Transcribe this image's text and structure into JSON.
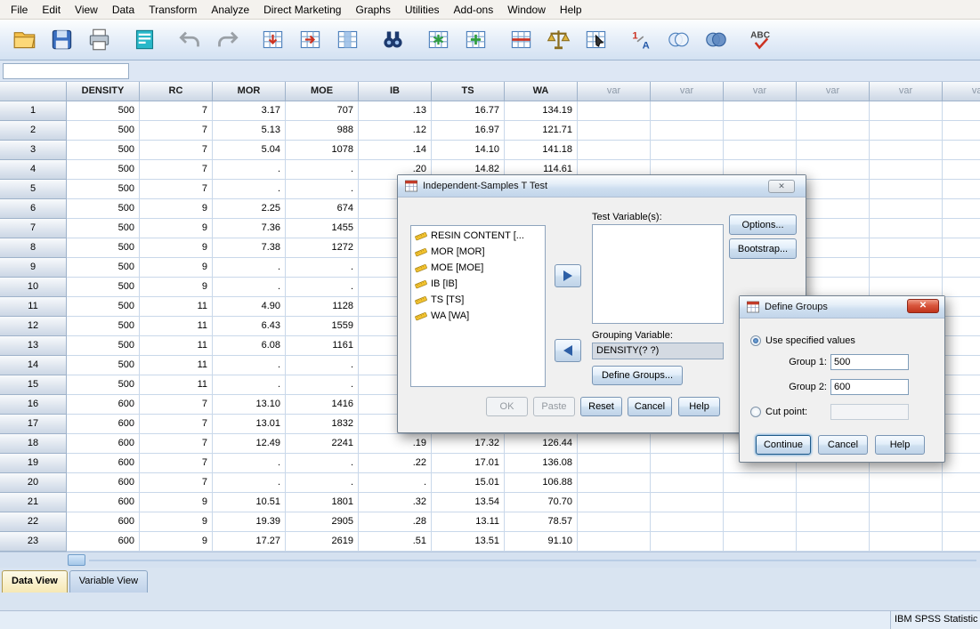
{
  "menu": {
    "items": [
      "File",
      "Edit",
      "View",
      "Data",
      "Transform",
      "Analyze",
      "Direct Marketing",
      "Graphs",
      "Utilities",
      "Add-ons",
      "Window",
      "Help"
    ]
  },
  "toolbar": {
    "buttons": [
      {
        "name": "open-data",
        "icon": "i-folder"
      },
      {
        "name": "save",
        "icon": "i-floppy"
      },
      {
        "name": "print",
        "icon": "i-printer"
      },
      {
        "name": "recall-dialogs",
        "icon": "i-recall"
      },
      {
        "name": "undo",
        "icon": "i-undo"
      },
      {
        "name": "redo",
        "icon": "i-redo"
      },
      {
        "name": "goto-case",
        "icon": "i-goto-case"
      },
      {
        "name": "goto-variable",
        "icon": "i-goto-var"
      },
      {
        "name": "variables",
        "icon": "i-varinfo"
      },
      {
        "name": "find",
        "icon": "i-binoc"
      },
      {
        "name": "insert-cases",
        "icon": "i-ins-case"
      },
      {
        "name": "insert-variable",
        "icon": "i-ins-var"
      },
      {
        "name": "split-file",
        "icon": "i-split"
      },
      {
        "name": "weight-cases",
        "icon": "i-scales"
      },
      {
        "name": "select-cases",
        "icon": "i-select"
      },
      {
        "name": "value-labels",
        "icon": "i-vlabels"
      },
      {
        "name": "use-variable-sets",
        "icon": "i-venn"
      },
      {
        "name": "show-all-variables",
        "icon": "i-venn2"
      },
      {
        "name": "spell-check",
        "icon": "i-abc"
      }
    ]
  },
  "cell_editor": {
    "value": ""
  },
  "grid": {
    "columns": [
      "DENSITY",
      "RC",
      "MOR",
      "MOE",
      "IB",
      "TS",
      "WA",
      "var",
      "var",
      "var",
      "var",
      "var",
      "var"
    ],
    "rows": [
      [
        "500",
        "7",
        "3.17",
        "707",
        ".13",
        "16.77",
        "134.19"
      ],
      [
        "500",
        "7",
        "5.13",
        "988",
        ".12",
        "16.97",
        "121.71"
      ],
      [
        "500",
        "7",
        "5.04",
        "1078",
        ".14",
        "14.10",
        "141.18"
      ],
      [
        "500",
        "7",
        ".",
        ".",
        ".20",
        "14.82",
        "114.61"
      ],
      [
        "500",
        "7",
        ".",
        ".",
        "",
        "",
        ""
      ],
      [
        "500",
        "9",
        "2.25",
        "674",
        "",
        "",
        ""
      ],
      [
        "500",
        "9",
        "7.36",
        "1455",
        "",
        "",
        ""
      ],
      [
        "500",
        "9",
        "7.38",
        "1272",
        "",
        "",
        ""
      ],
      [
        "500",
        "9",
        ".",
        ".",
        "",
        "",
        ""
      ],
      [
        "500",
        "9",
        ".",
        ".",
        "",
        "",
        ""
      ],
      [
        "500",
        "11",
        "4.90",
        "1128",
        "",
        "",
        ""
      ],
      [
        "500",
        "11",
        "6.43",
        "1559",
        "",
        "",
        ""
      ],
      [
        "500",
        "11",
        "6.08",
        "1161",
        "",
        "",
        ""
      ],
      [
        "500",
        "11",
        ".",
        ".",
        "",
        "",
        ""
      ],
      [
        "500",
        "11",
        ".",
        ".",
        "",
        "",
        ""
      ],
      [
        "600",
        "7",
        "13.10",
        "1416",
        "",
        "",
        ""
      ],
      [
        "600",
        "7",
        "13.01",
        "1832",
        "",
        "",
        ""
      ],
      [
        "600",
        "7",
        "12.49",
        "2241",
        ".19",
        "17.32",
        "126.44"
      ],
      [
        "600",
        "7",
        ".",
        ".",
        ".22",
        "17.01",
        "136.08"
      ],
      [
        "600",
        "7",
        ".",
        ".",
        ".",
        "15.01",
        "106.88"
      ],
      [
        "600",
        "9",
        "10.51",
        "1801",
        ".32",
        "13.54",
        "70.70"
      ],
      [
        "600",
        "9",
        "19.39",
        "2905",
        ".28",
        "13.11",
        "78.57"
      ],
      [
        "600",
        "9",
        "17.27",
        "2619",
        ".51",
        "13.51",
        "91.10"
      ]
    ]
  },
  "tabs": {
    "data_view": "Data View",
    "variable_view": "Variable View"
  },
  "status": {
    "right": "IBM SPSS Statistic"
  },
  "ttest_dialog": {
    "title": "Independent-Samples T Test",
    "close": "✕",
    "variables": [
      "RESIN CONTENT [...",
      "MOR [MOR]",
      "MOE [MOE]",
      "IB [IB]",
      "TS [TS]",
      "WA [WA]"
    ],
    "test_label": "Test Variable(s):",
    "grouping_label": "Grouping Variable:",
    "grouping_value": "DENSITY(? ?)",
    "buttons": {
      "options": "Options...",
      "bootstrap": "Bootstrap...",
      "define_groups": "Define Groups...",
      "ok": "OK",
      "paste": "Paste",
      "reset": "Reset",
      "cancel": "Cancel",
      "help": "Help"
    }
  },
  "define_groups_dialog": {
    "title": "Define Groups",
    "close": "✕",
    "use_specified_label": "Use specified values",
    "group1_label": "Group 1:",
    "group1_value": "500",
    "group2_label": "Group 2:",
    "group2_value": "600",
    "cut_point_label": "Cut point:",
    "cut_point_value": "",
    "buttons": {
      "continue": "Continue",
      "cancel": "Cancel",
      "help": "Help"
    }
  },
  "colors": {
    "accent_blue": "#2d5fa6",
    "close_red": "#c0341c",
    "grid_line": "#c9d8ea"
  }
}
